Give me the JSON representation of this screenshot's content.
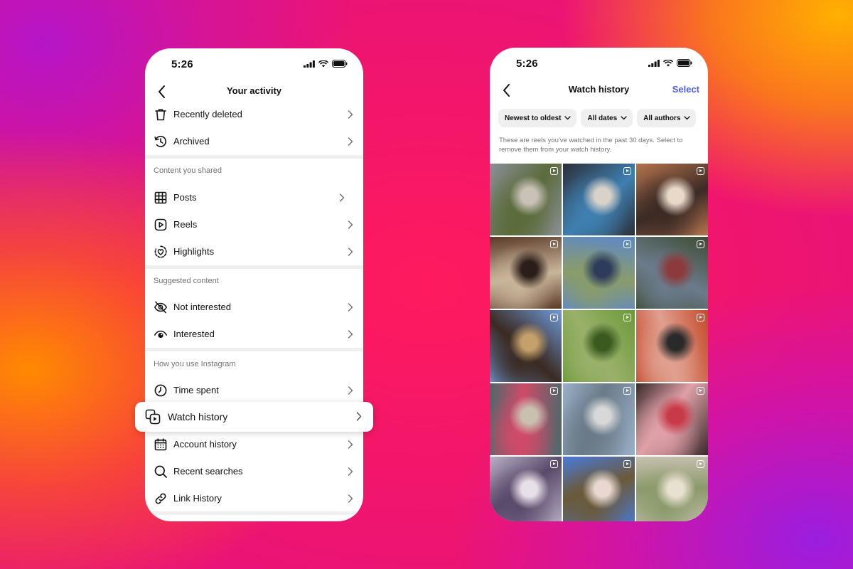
{
  "left_phone": {
    "status_time": "5:26",
    "title": "Your activity",
    "items_top": [
      {
        "label": "Recently deleted",
        "icon": "trash-icon"
      },
      {
        "label": "Archived",
        "icon": "archive-icon"
      }
    ],
    "section_shared": "Content you shared",
    "items_shared": [
      {
        "label": "Posts",
        "icon": "grid-icon"
      },
      {
        "label": "Reels",
        "icon": "reels-icon"
      },
      {
        "label": "Highlights",
        "icon": "highlights-icon"
      }
    ],
    "section_suggested": "Suggested content",
    "items_suggested": [
      {
        "label": "Not interested",
        "icon": "eye-off-icon"
      },
      {
        "label": "Interested",
        "icon": "eye-icon"
      }
    ],
    "section_usage": "How you use Instagram",
    "items_usage": [
      {
        "label": "Time spent",
        "icon": "clock-icon"
      },
      {
        "label": "Watch history",
        "icon": "watch-history-icon"
      },
      {
        "label": "Account history",
        "icon": "calendar-icon"
      },
      {
        "label": "Recent searches",
        "icon": "search-icon"
      },
      {
        "label": "Link History",
        "icon": "link-icon"
      }
    ]
  },
  "right_phone": {
    "status_time": "5:26",
    "title": "Watch history",
    "select_label": "Select",
    "filters": [
      "Newest to oldest",
      "All dates",
      "All authors"
    ],
    "info_text": "These are reels you've watched in the past 30 days. Select to remove them from your watch history.",
    "thumbnails": [
      {
        "colors": [
          "#8a8f96",
          "#5b6b3a",
          "#c9c2b8"
        ]
      },
      {
        "colors": [
          "#2c2f38",
          "#3f7fb0",
          "#d9d2c8"
        ]
      },
      {
        "colors": [
          "#b5744e",
          "#3b2a25",
          "#e8d9c8"
        ]
      },
      {
        "colors": [
          "#5a3a28",
          "#c9b59a",
          "#2b1e18"
        ]
      },
      {
        "colors": [
          "#5d88c9",
          "#8a9c6a",
          "#2c3c5a"
        ]
      },
      {
        "colors": [
          "#3e4c32",
          "#6b7b8c",
          "#8c3a3a"
        ]
      },
      {
        "colors": [
          "#6f9ad8",
          "#3a2a22",
          "#c4a06a"
        ]
      },
      {
        "colors": [
          "#6a9a3a",
          "#9ab06a",
          "#3a5a20"
        ]
      },
      {
        "colors": [
          "#c44a2a",
          "#e0a090",
          "#2a2a2a"
        ]
      },
      {
        "colors": [
          "#4a6a6a",
          "#d04a6a",
          "#c9c0b0"
        ]
      },
      {
        "colors": [
          "#9ab0c8",
          "#6a7a88",
          "#d8d8d8"
        ]
      },
      {
        "colors": [
          "#3a2a2a",
          "#e0a0a8",
          "#c83a4a"
        ]
      },
      {
        "colors": [
          "#b8b0c8",
          "#5a4a6a",
          "#e8e0e8"
        ]
      },
      {
        "colors": [
          "#4a7ad8",
          "#6a5a3a",
          "#e8d8d0"
        ]
      },
      {
        "colors": [
          "#c8c0b0",
          "#8a9a6a",
          "#e8e0d0"
        ]
      }
    ]
  }
}
